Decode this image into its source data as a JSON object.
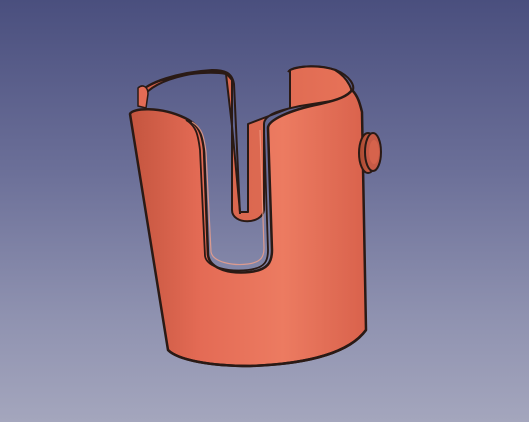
{
  "viewport": {
    "background_top": "#4a4f7e",
    "background_bottom": "#a4a6bd"
  },
  "model": {
    "shape": "u-slotted-cylindrical-cup-holder",
    "body_color": "#e46b55",
    "shadow_color": "#b9533f",
    "highlight_color": "#f08a70",
    "edge_color": "#2a1a15",
    "pin_color": "#c75a46"
  }
}
